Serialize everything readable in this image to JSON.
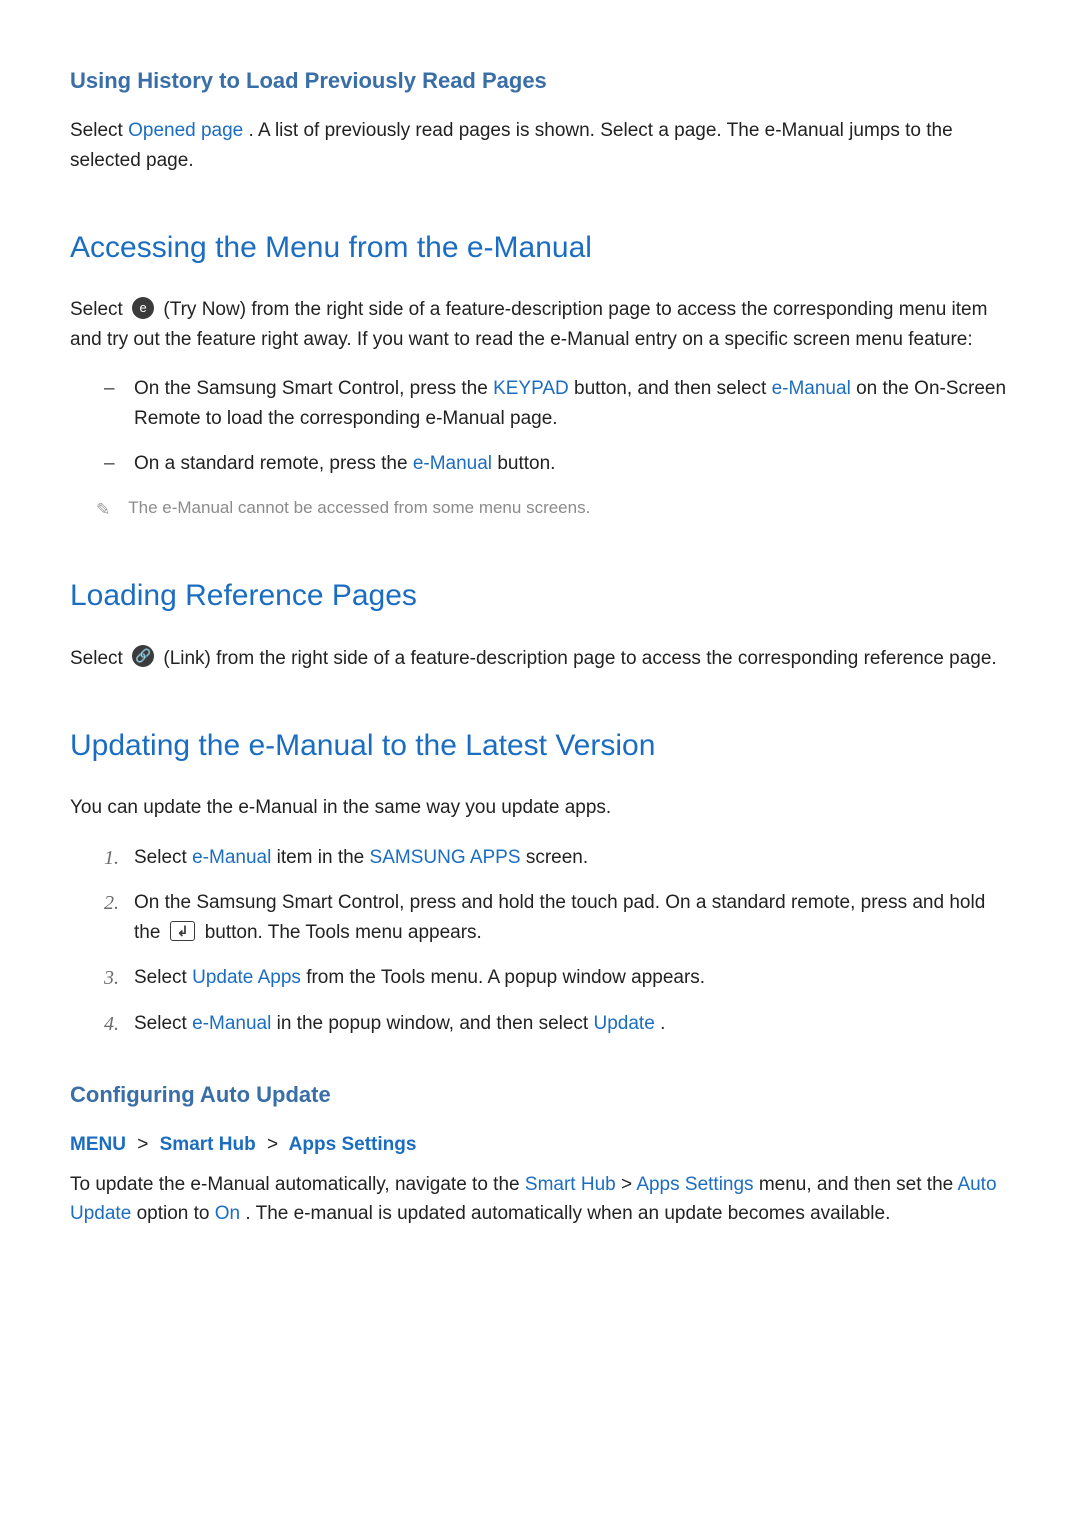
{
  "section_history": {
    "title": "Using History to Load Previously Read Pages",
    "p_a": "Select ",
    "p_b": "Opened page",
    "p_c": ". A list of previously read pages is shown. Select a page. The e-Manual jumps to the selected page."
  },
  "section_access": {
    "title": "Accessing the Menu from the e-Manual",
    "intro_a": "Select ",
    "intro_b": " (Try Now) from the right side of a feature-description page to access the corresponding menu item and try out the feature right away. If you want to read the e-Manual entry on a specific screen menu feature:",
    "badge_glyph": "e",
    "bullets": [
      {
        "a": "On the Samsung Smart Control, press the ",
        "b": "KEYPAD",
        "c": " button, and then select ",
        "d": "e-Manual",
        "e": " on the On-Screen Remote to load the corresponding e-Manual page."
      },
      {
        "a": "On a standard remote, press the ",
        "b": "e-Manual",
        "c": " button."
      }
    ],
    "note": "The e-Manual cannot be accessed from some menu screens."
  },
  "section_ref": {
    "title": "Loading Reference Pages",
    "intro_a": "Select ",
    "intro_b": " (Link) from the right side of a feature-description page to access the corresponding reference page.",
    "badge_glyph": "🔗"
  },
  "section_update": {
    "title": "Updating the e-Manual to the Latest Version",
    "intro": "You can update the e-Manual in the same way you update apps.",
    "steps": [
      {
        "num": "1.",
        "a": "Select ",
        "b": "e-Manual",
        "c": " item in the ",
        "d": "SAMSUNG APPS",
        "e": " screen."
      },
      {
        "num": "2.",
        "a": "On the Samsung Smart Control, press and hold the touch pad. On a standard remote, press and hold the ",
        "enter_glyph": "↲",
        "c": " button. The Tools menu appears."
      },
      {
        "num": "3.",
        "a": "Select ",
        "b": "Update Apps",
        "c": " from the Tools menu. A popup window appears."
      },
      {
        "num": "4.",
        "a": "Select ",
        "b": "e-Manual",
        "c": " in the popup window, and then select ",
        "d": "Update",
        "e": "."
      }
    ]
  },
  "section_auto": {
    "title": "Configuring Auto Update",
    "crumb": [
      "MENU",
      "Smart Hub",
      "Apps Settings"
    ],
    "p_a": "To update the e-Manual automatically, navigate to the ",
    "p_b": "Smart Hub",
    "p_c": " > ",
    "p_d": "Apps Settings",
    "p_e": " menu, and then set the ",
    "p_f": "Auto Update",
    "p_g": " option to ",
    "p_h": "On",
    "p_i": ". The e-manual is updated automatically when an update becomes available."
  }
}
